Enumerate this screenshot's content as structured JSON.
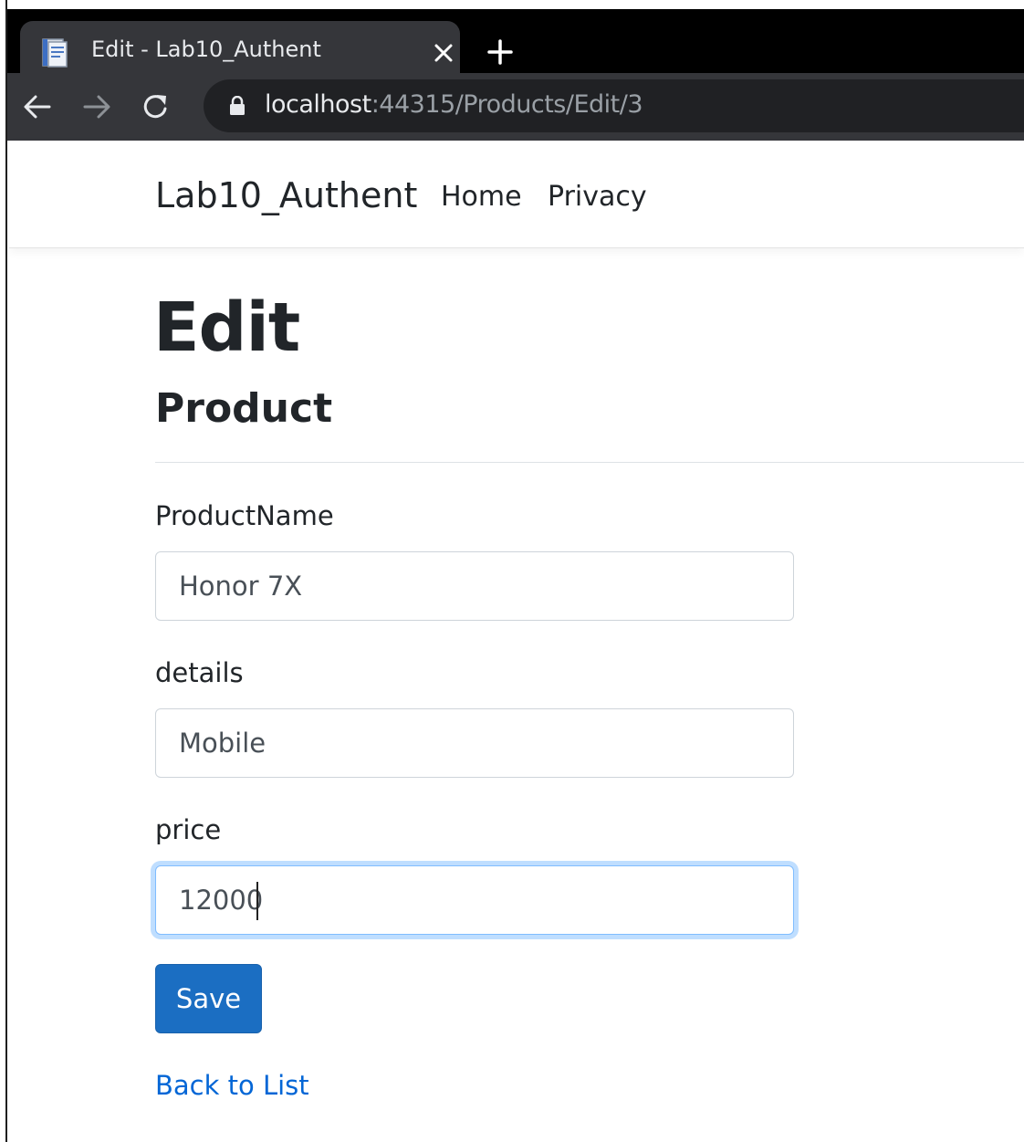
{
  "browser": {
    "tab_title": "Edit - Lab10_Authent",
    "url_host": "localhost",
    "url_path": ":44315/Products/Edit/3"
  },
  "icons": {
    "favicon": "document-icon",
    "close": "close-icon",
    "new_tab": "plus-icon",
    "back": "arrow-left-icon",
    "forward": "arrow-right-icon",
    "reload": "reload-icon",
    "lock": "lock-icon"
  },
  "navbar": {
    "brand": "Lab10_Authent",
    "links": [
      "Home",
      "Privacy"
    ]
  },
  "page": {
    "title": "Edit",
    "subtitle": "Product"
  },
  "form": {
    "product_name_label": "ProductName",
    "product_name_value": "Honor 7X",
    "details_label": "details",
    "details_value": "Mobile",
    "price_label": "price",
    "price_value": "12000",
    "save_label": "Save",
    "back_label": "Back to List"
  },
  "colors": {
    "primary_button": "#1b6ec2",
    "link": "#0366d6",
    "focus_ring": "#80bdff"
  }
}
